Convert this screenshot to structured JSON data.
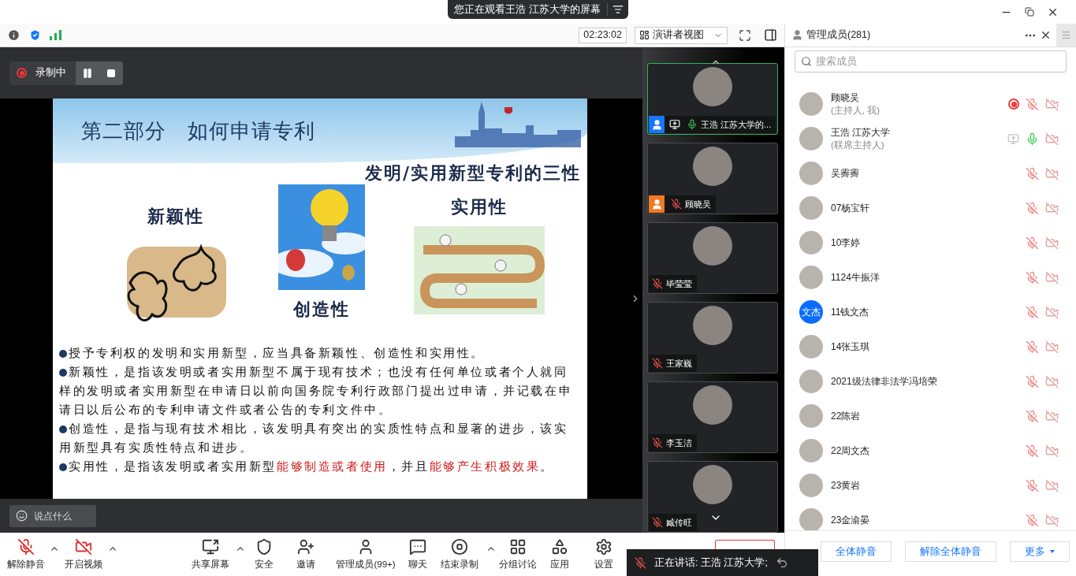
{
  "title_bar": {
    "viewing_label": "您正在观看王浩 江苏大学的屏幕"
  },
  "toolbar": {
    "timer": "02:23:02",
    "view_mode": "演讲者视图"
  },
  "recording": {
    "label": "录制中"
  },
  "slide": {
    "title": "第二部分　如何申请专利",
    "subtitle": "发明/实用新型专利的三性",
    "features": [
      {
        "label": "新颖性"
      },
      {
        "label": "创造性"
      },
      {
        "label": "实用性"
      }
    ],
    "paragraphs": [
      {
        "bullet": true,
        "segments": [
          {
            "text": "授予专利权的发明和实用新型，应当具备新颖性、创造性和实用性。",
            "highlight": false
          }
        ]
      },
      {
        "bullet": true,
        "segments": [
          {
            "text": "新颖性，是指该发明或者实用新型不属于现有技术；也没有任何单位或者个人就同样的发明或者实用新型在申请日以前向国务院专利行政部门提出过申请，并记载在申请日以后公布的专利申请文件或者公告的专利文件中。",
            "highlight": false
          }
        ]
      },
      {
        "bullet": true,
        "segments": [
          {
            "text": "创造性，是指与现有技术相比，该发明具有突出的实质性特点和显著的进步，该实用新型具有实质性特点和进步。",
            "highlight": false
          }
        ]
      },
      {
        "bullet": true,
        "segments": [
          {
            "text": "实用性，是指该发明或者实用新型",
            "highlight": false
          },
          {
            "text": "能够制造或者使用",
            "highlight": true
          },
          {
            "text": "，并且",
            "highlight": false
          },
          {
            "text": "能够产生积极效果",
            "highlight": true
          },
          {
            "text": "。",
            "highlight": false
          }
        ]
      }
    ]
  },
  "chat_input": {
    "placeholder": "说点什么"
  },
  "video_tiles": [
    {
      "name": "王浩 江苏大学的...",
      "selected": true,
      "kind": "cohost",
      "sharing": true,
      "mic_on": true
    },
    {
      "name": "顾晓吴",
      "selected": false,
      "kind": "host",
      "sharing": false,
      "mic_on": false
    },
    {
      "name": "毕莹莹",
      "selected": false,
      "kind": "member",
      "sharing": false,
      "mic_on": false
    },
    {
      "name": "王家巍",
      "selected": false,
      "kind": "member",
      "sharing": false,
      "mic_on": false
    },
    {
      "name": "李玉洁",
      "selected": false,
      "kind": "member",
      "sharing": false,
      "mic_on": false
    },
    {
      "name": "臧传旺",
      "selected": false,
      "kind": "member",
      "sharing": false,
      "mic_on": false
    }
  ],
  "members_panel": {
    "title": "管理成员(281)",
    "search": {
      "placeholder": "搜索成员"
    },
    "members": [
      {
        "name": "顾晓吴",
        "role": "(主持人, 我)",
        "recording": true,
        "sharing": false,
        "mic_on": false
      },
      {
        "name": "王浩 江苏大学",
        "role": "(联席主持人)",
        "recording": false,
        "sharing": true,
        "mic_on": true
      },
      {
        "name": "吴霽霽",
        "recording": false,
        "sharing": false,
        "mic_on": false
      },
      {
        "name": "07杨宝轩",
        "recording": false,
        "sharing": false,
        "mic_on": false
      },
      {
        "name": "10李婷",
        "recording": false,
        "sharing": false,
        "mic_on": false
      },
      {
        "name": "1124牛振洋",
        "recording": false,
        "sharing": false,
        "mic_on": false
      },
      {
        "name": "11钱文杰",
        "initials": "文杰",
        "recording": false,
        "sharing": false,
        "mic_on": false
      },
      {
        "name": "14张玉琪",
        "recording": false,
        "sharing": false,
        "mic_on": false
      },
      {
        "name": "2021级法律非法学冯培荣",
        "recording": false,
        "sharing": false,
        "mic_on": false
      },
      {
        "name": "22陈岩",
        "recording": false,
        "sharing": false,
        "mic_on": false
      },
      {
        "name": "22周文杰",
        "recording": false,
        "sharing": false,
        "mic_on": false
      },
      {
        "name": "23黄岩",
        "recording": false,
        "sharing": false,
        "mic_on": false
      },
      {
        "name": "23金渝晏",
        "recording": false,
        "sharing": false,
        "mic_on": false
      }
    ],
    "buttons": [
      {
        "label": "全体静音",
        "kind": "plain"
      },
      {
        "label": "解除全体静音",
        "kind": "plain"
      },
      {
        "label": "更多",
        "kind": "menu"
      }
    ]
  },
  "bottom_toolbar": [
    {
      "label": "解除静音",
      "caret": true
    },
    {
      "label": "开启视频",
      "caret": true
    },
    {
      "label": "共享屏幕",
      "caret": true
    },
    {
      "label": "安全",
      "caret": false
    },
    {
      "label": "邀请",
      "caret": false
    },
    {
      "label": "管理成员(99+)",
      "caret": false
    },
    {
      "label": "聊天",
      "caret": false
    },
    {
      "label": "结束录制",
      "caret": true
    },
    {
      "label": "分组讨论",
      "caret": false
    },
    {
      "label": "应用",
      "caret": false
    },
    {
      "label": "设置",
      "caret": false
    }
  ],
  "speaking": {
    "label": "正在讲话: 王浩 江苏大学;"
  }
}
